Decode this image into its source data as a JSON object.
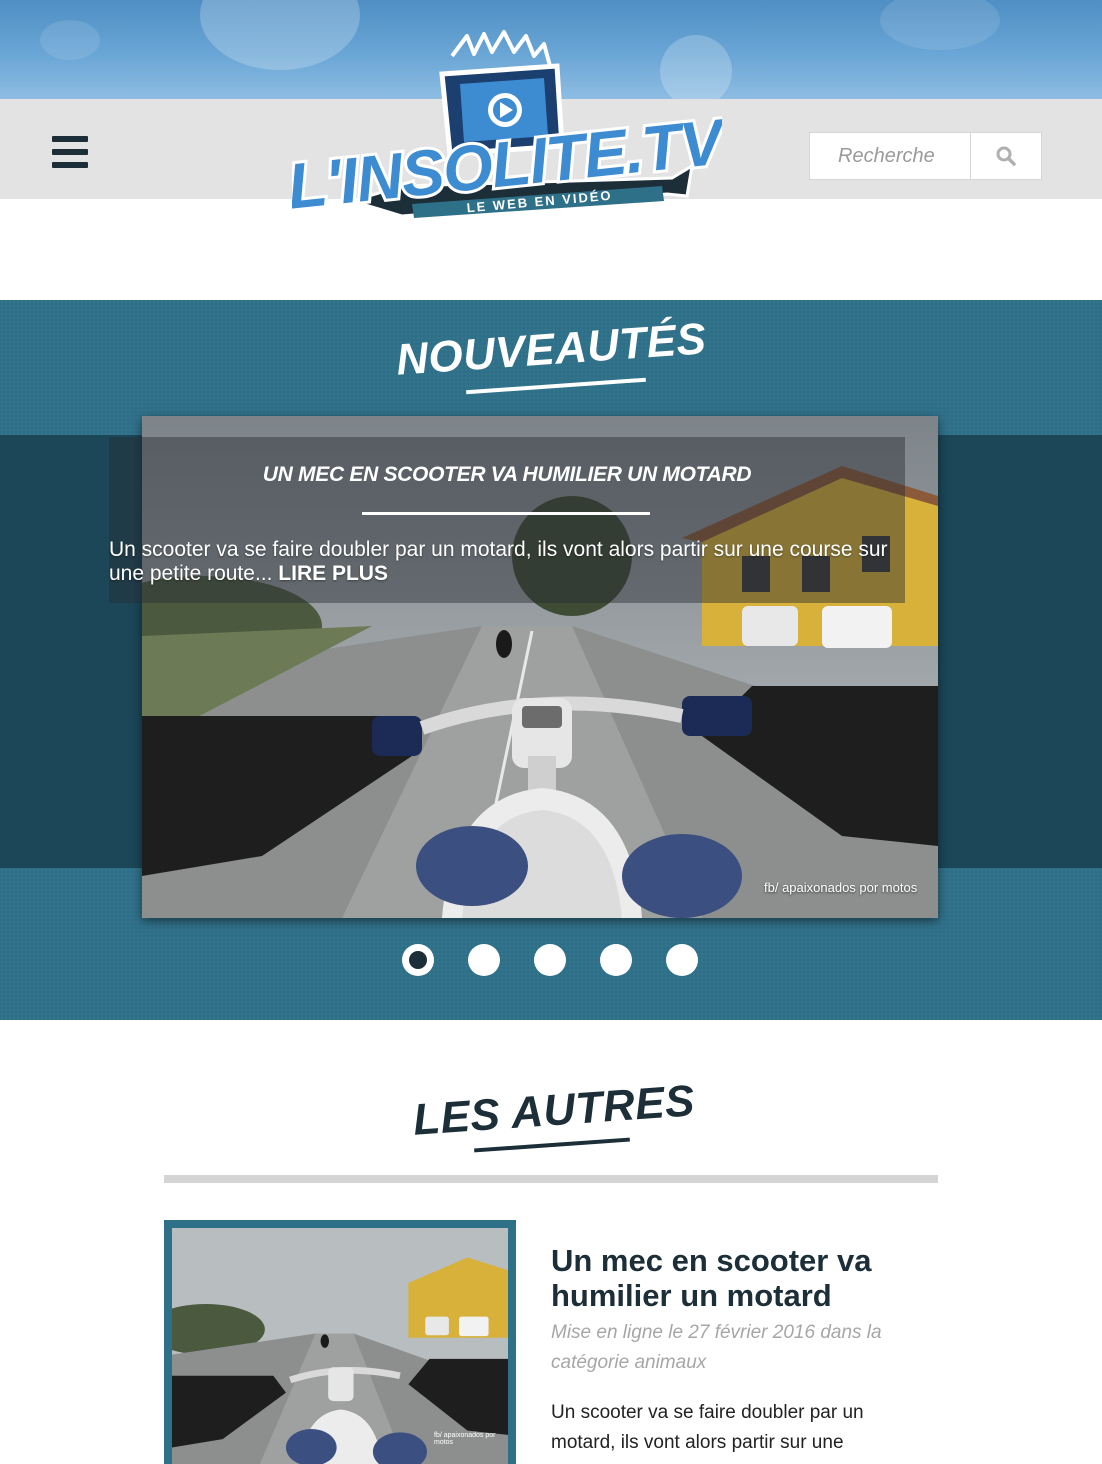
{
  "brand": {
    "logo_text": "L'INSOLITE.TV",
    "tagline": "LE WEB EN VIDÉO"
  },
  "header": {
    "menu_icon": "hamburger-icon",
    "search": {
      "placeholder": "Recherche",
      "icon": "search-icon"
    }
  },
  "news": {
    "title": "NOUVEAUTÉS",
    "slide": {
      "title": "UN MEC EN SCOOTER VA HUMILIER UN MOTARD",
      "text": "Un scooter va se faire doubler par un motard, ils vont alors partir sur une course sur une petite route...",
      "more": "LIRE PLUS",
      "credit": "fb/ apaixonados por motos"
    },
    "dots": 5,
    "active_dot": 1
  },
  "others": {
    "title": "LES AUTRES",
    "article": {
      "title": "Un mec en scooter va humilier un motard",
      "meta": "Mise en ligne le 27 février 2016 dans la catégorie animaux",
      "excerpt": "Un scooter va se faire doubler par un motard, ils vont alors partir sur une",
      "credit": "fb/ apaixonados por motos"
    }
  },
  "colors": {
    "teal": "#2f7089",
    "dark_teal": "#1b4759",
    "navy": "#1c2e38",
    "header_gray": "#e3e3e3"
  }
}
